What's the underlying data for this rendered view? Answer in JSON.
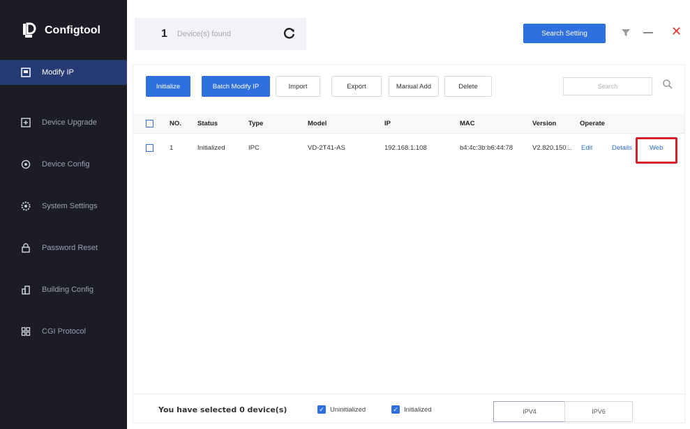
{
  "app": {
    "logo_text": "Configtool"
  },
  "sidebar": {
    "items": [
      {
        "label": "Modify IP",
        "icon": "modify-ip-icon"
      },
      {
        "label": "Device Upgrade",
        "icon": "upgrade-icon"
      },
      {
        "label": "Device Config",
        "icon": "device-config-icon"
      },
      {
        "label": "System Settings",
        "icon": "system-settings-icon"
      },
      {
        "label": "Password Reset",
        "icon": "password-reset-icon"
      },
      {
        "label": "Building Config",
        "icon": "building-config-icon"
      },
      {
        "label": "CGI Protocol",
        "icon": "cgi-protocol-icon"
      }
    ]
  },
  "topbar": {
    "device_count": "1",
    "device_label": "Device(s) found",
    "search_setting_label": "Search Setting"
  },
  "toolbar": {
    "initialize": "Initialize",
    "batch_modify": "Batch Modify IP",
    "import": "Import",
    "export": "Export",
    "manual_add": "Manual Add",
    "delete": "Delete",
    "search_placeholder": "Search"
  },
  "table": {
    "headers": [
      "NO.",
      "Status",
      "Type",
      "Model",
      "IP",
      "MAC",
      "Version",
      "Operate"
    ],
    "rows": [
      {
        "no": "1",
        "status": "Initialized",
        "type": "IPC",
        "model": "VD-2T41-AS",
        "ip": "192.168.1.108",
        "mac": "b4:4c:3b:b6:44:78",
        "version": "V2.820.150...",
        "edit": "Edit",
        "details": "Details",
        "web": "Web"
      }
    ]
  },
  "footer": {
    "selected_text": "You have selected 0 device(s)",
    "uninitialized": "Uninitialized",
    "initialized": "Initialized",
    "ipv4": "IPV4",
    "ipv6": "IPV6"
  },
  "colors": {
    "accent": "#2f6fde",
    "sidebar_bg": "#1b1c26",
    "highlight": "#d5212a"
  }
}
